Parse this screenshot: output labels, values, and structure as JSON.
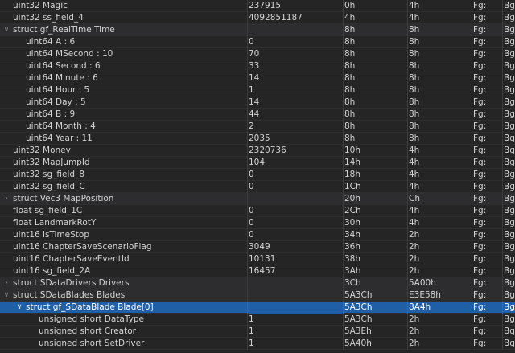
{
  "rows": [
    {
      "name": "uint32 Magic",
      "value": "237915",
      "start": "0h",
      "size": "4h",
      "fg": "Fg:",
      "bg": "Bg",
      "indent": 1,
      "chevron": "",
      "type": "field"
    },
    {
      "name": "uint32 ss_field_4",
      "value": "4092851187",
      "start": "4h",
      "size": "4h",
      "fg": "Fg:",
      "bg": "Bg",
      "indent": 1,
      "chevron": "",
      "type": "field"
    },
    {
      "name": "struct gf_RealTime Time",
      "value": "",
      "start": "8h",
      "size": "8h",
      "fg": "Fg:",
      "bg": "Bg",
      "indent": 1,
      "chevron": "expanded",
      "type": "struct"
    },
    {
      "name": "uint64 A : 6",
      "value": "0",
      "start": "8h",
      "size": "8h",
      "fg": "Fg:",
      "bg": "Bg",
      "indent": 2,
      "chevron": "",
      "type": "field"
    },
    {
      "name": "uint64 MSecond : 10",
      "value": "70",
      "start": "8h",
      "size": "8h",
      "fg": "Fg:",
      "bg": "Bg",
      "indent": 2,
      "chevron": "",
      "type": "field"
    },
    {
      "name": "uint64 Second : 6",
      "value": "33",
      "start": "8h",
      "size": "8h",
      "fg": "Fg:",
      "bg": "Bg",
      "indent": 2,
      "chevron": "",
      "type": "field"
    },
    {
      "name": "uint64 Minute : 6",
      "value": "14",
      "start": "8h",
      "size": "8h",
      "fg": "Fg:",
      "bg": "Bg",
      "indent": 2,
      "chevron": "",
      "type": "field"
    },
    {
      "name": "uint64 Hour : 5",
      "value": "1",
      "start": "8h",
      "size": "8h",
      "fg": "Fg:",
      "bg": "Bg",
      "indent": 2,
      "chevron": "",
      "type": "field"
    },
    {
      "name": "uint64 Day : 5",
      "value": "14",
      "start": "8h",
      "size": "8h",
      "fg": "Fg:",
      "bg": "Bg",
      "indent": 2,
      "chevron": "",
      "type": "field"
    },
    {
      "name": "uint64 B : 9",
      "value": "44",
      "start": "8h",
      "size": "8h",
      "fg": "Fg:",
      "bg": "Bg",
      "indent": 2,
      "chevron": "",
      "type": "field"
    },
    {
      "name": "uint64 Month : 4",
      "value": "2",
      "start": "8h",
      "size": "8h",
      "fg": "Fg:",
      "bg": "Bg",
      "indent": 2,
      "chevron": "",
      "type": "field"
    },
    {
      "name": "uint64 Year : 11",
      "value": "2035",
      "start": "8h",
      "size": "8h",
      "fg": "Fg:",
      "bg": "Bg",
      "indent": 2,
      "chevron": "",
      "type": "field"
    },
    {
      "name": "uint32 Money",
      "value": "2320736",
      "start": "10h",
      "size": "4h",
      "fg": "Fg:",
      "bg": "Bg",
      "indent": 1,
      "chevron": "",
      "type": "field"
    },
    {
      "name": "uint32 MapJumpId",
      "value": "104",
      "start": "14h",
      "size": "4h",
      "fg": "Fg:",
      "bg": "Bg",
      "indent": 1,
      "chevron": "",
      "type": "field"
    },
    {
      "name": "uint32 sg_field_8",
      "value": "0",
      "start": "18h",
      "size": "4h",
      "fg": "Fg:",
      "bg": "Bg",
      "indent": 1,
      "chevron": "",
      "type": "field"
    },
    {
      "name": "uint32 sg_field_C",
      "value": "0",
      "start": "1Ch",
      "size": "4h",
      "fg": "Fg:",
      "bg": "Bg",
      "indent": 1,
      "chevron": "",
      "type": "field"
    },
    {
      "name": "struct Vec3 MapPosition",
      "value": "",
      "start": "20h",
      "size": "Ch",
      "fg": "Fg:",
      "bg": "Bg",
      "indent": 1,
      "chevron": "collapsed",
      "type": "struct"
    },
    {
      "name": "float sg_field_1C",
      "value": "0",
      "start": "2Ch",
      "size": "4h",
      "fg": "Fg:",
      "bg": "Bg",
      "indent": 1,
      "chevron": "",
      "type": "field"
    },
    {
      "name": "float LandmarkRotY",
      "value": "0",
      "start": "30h",
      "size": "4h",
      "fg": "Fg:",
      "bg": "Bg",
      "indent": 1,
      "chevron": "",
      "type": "field"
    },
    {
      "name": "uint16 isTimeStop",
      "value": "0",
      "start": "34h",
      "size": "2h",
      "fg": "Fg:",
      "bg": "Bg",
      "indent": 1,
      "chevron": "",
      "type": "field"
    },
    {
      "name": "uint16 ChapterSaveScenarioFlag",
      "value": "3049",
      "start": "36h",
      "size": "2h",
      "fg": "Fg:",
      "bg": "Bg",
      "indent": 1,
      "chevron": "",
      "type": "field"
    },
    {
      "name": "uint16 ChapterSaveEventId",
      "value": "10131",
      "start": "38h",
      "size": "2h",
      "fg": "Fg:",
      "bg": "Bg",
      "indent": 1,
      "chevron": "",
      "type": "field"
    },
    {
      "name": "uint16 sg_field_2A",
      "value": "16457",
      "start": "3Ah",
      "size": "2h",
      "fg": "Fg:",
      "bg": "Bg",
      "indent": 1,
      "chevron": "",
      "type": "field"
    },
    {
      "name": "struct SDataDrivers Drivers",
      "value": "",
      "start": "3Ch",
      "size": "5A00h",
      "fg": "Fg:",
      "bg": "Bg",
      "indent": 1,
      "chevron": "collapsed",
      "type": "struct"
    },
    {
      "name": "struct SDataBlades Blades",
      "value": "",
      "start": "5A3Ch",
      "size": "E3E58h",
      "fg": "Fg:",
      "bg": "Bg",
      "indent": 1,
      "chevron": "expanded",
      "type": "struct"
    },
    {
      "name": "struct gf_SDataBlade Blade[0]",
      "value": "",
      "start": "5A3Ch",
      "size": "8A4h",
      "fg": "Fg:",
      "bg": "Bg",
      "indent": 2,
      "chevron": "expanded",
      "type": "struct",
      "selected": true
    },
    {
      "name": "unsigned short DataType",
      "value": "1",
      "start": "5A3Ch",
      "size": "2h",
      "fg": "Fg:",
      "bg": "Bg",
      "indent": 3,
      "chevron": "",
      "type": "field"
    },
    {
      "name": "unsigned short Creator",
      "value": "1",
      "start": "5A3Eh",
      "size": "2h",
      "fg": "Fg:",
      "bg": "Bg",
      "indent": 3,
      "chevron": "",
      "type": "field"
    },
    {
      "name": "unsigned short SetDriver",
      "value": "1",
      "start": "5A40h",
      "size": "2h",
      "fg": "Fg:",
      "bg": "Bg",
      "indent": 3,
      "chevron": "",
      "type": "field"
    }
  ]
}
